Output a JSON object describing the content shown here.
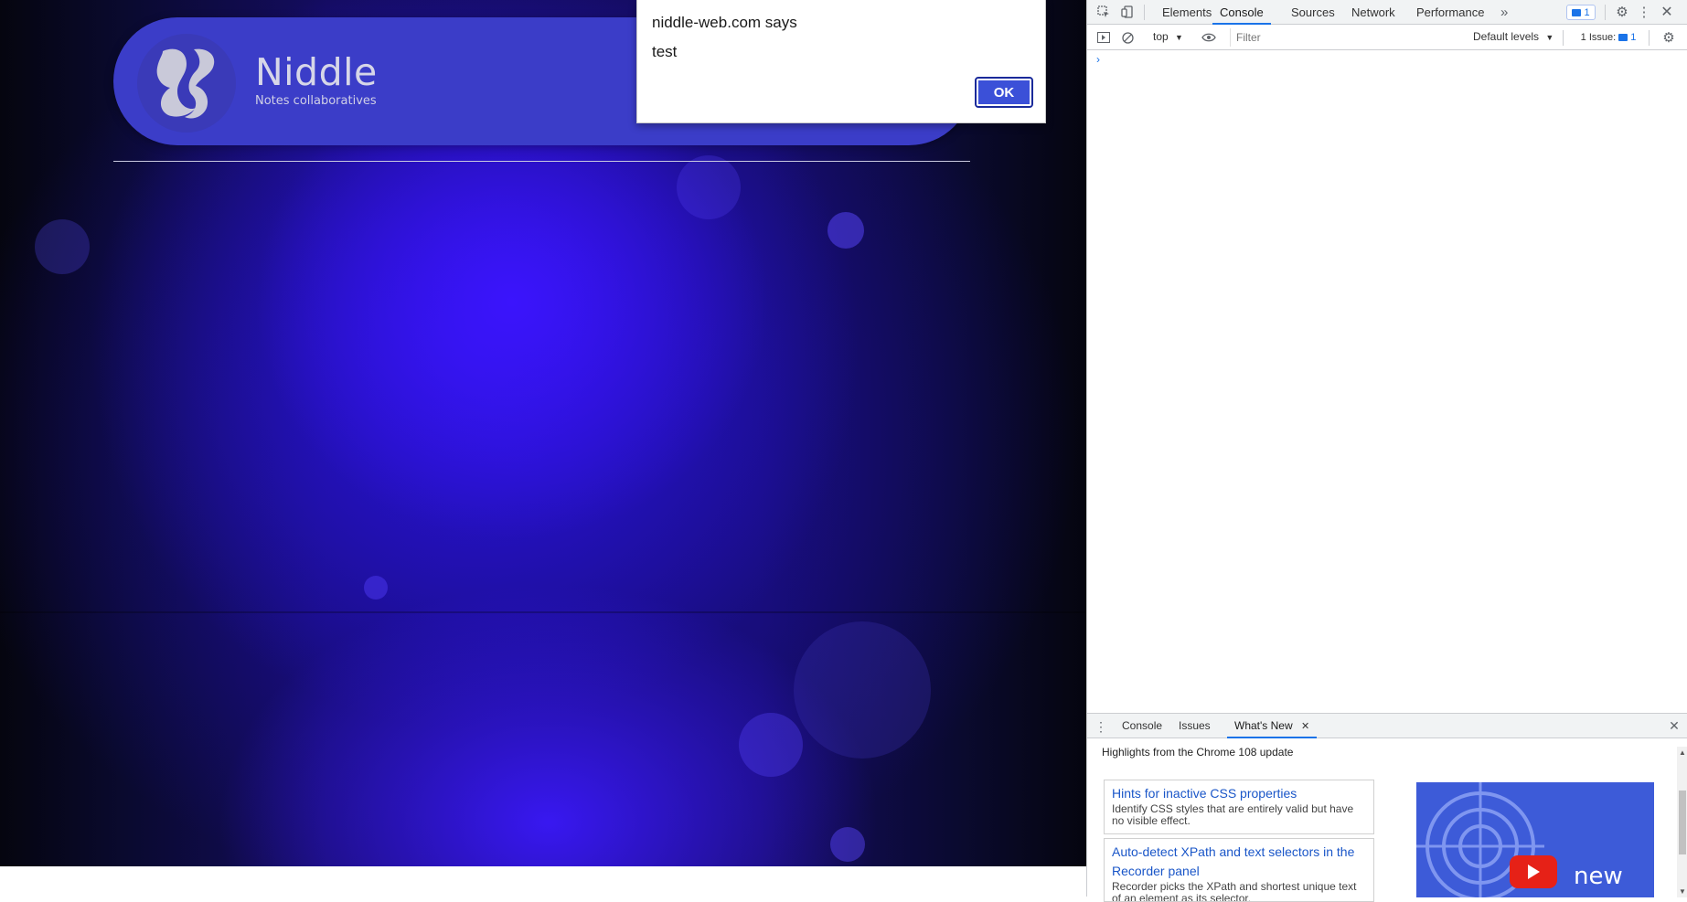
{
  "site": {
    "title": "Niddle",
    "subtitle": "Notes collaboratives"
  },
  "alert": {
    "title": "niddle-web.com says",
    "message": "test",
    "ok_label": "OK"
  },
  "devtools": {
    "tabs": [
      "Elements",
      "Console",
      "Sources",
      "Network",
      "Performance"
    ],
    "active_tab": "Console",
    "more_tabs_glyph": "»",
    "issues_badge": "1",
    "toolbar": {
      "context": "top",
      "filter_placeholder": "Filter",
      "levels": "Default levels",
      "issues_label": "1 Issue:",
      "issues_count": "1"
    },
    "prompt_glyph": "›",
    "drawer": {
      "tabs": [
        "Console",
        "Issues",
        "What's New"
      ],
      "active_tab": "What's New",
      "heading": "Highlights from the Chrome 108 update",
      "cards": [
        {
          "title": "Hints for inactive CSS properties",
          "desc": "Identify CSS styles that are entirely valid but have no visible effect."
        },
        {
          "title": "Auto-detect XPath and text selectors in the Recorder panel",
          "desc": "Recorder picks the XPath and shortest unique text of an element as its selector."
        }
      ],
      "promo_text": "new"
    }
  },
  "colors": {
    "header_bg": "#3b3dc8",
    "ok_button": "#3b50d8",
    "devtools_accent": "#1a73e8"
  }
}
